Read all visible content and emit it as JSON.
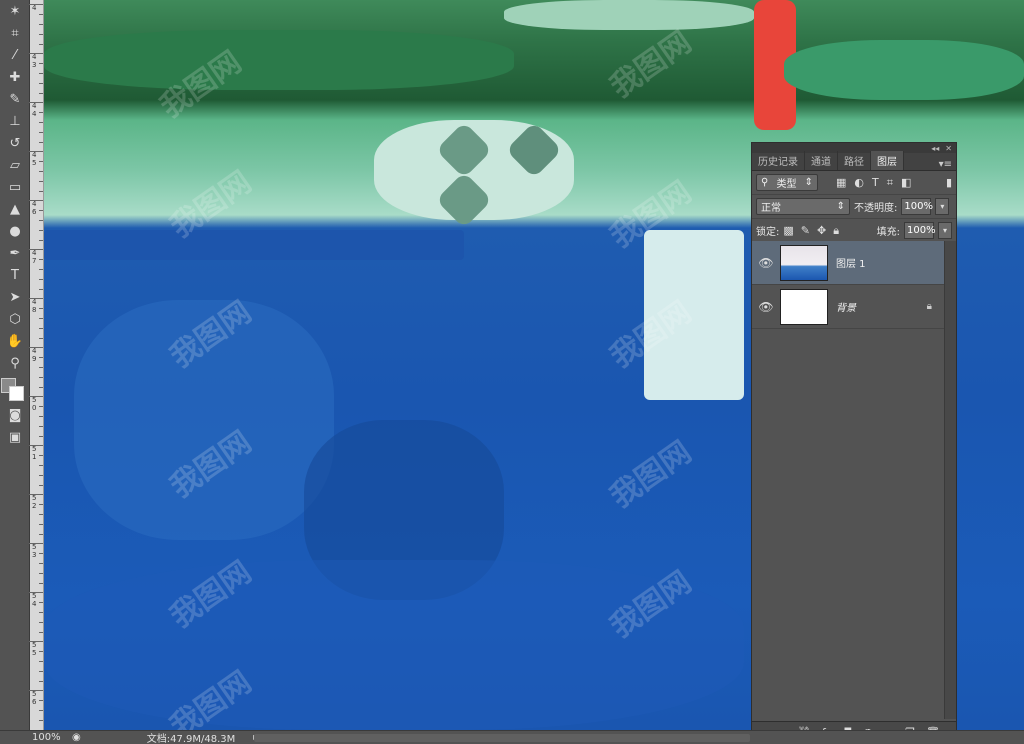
{
  "toolbar": {
    "tools": [
      {
        "name": "magic-wand-icon",
        "glyph": "✶"
      },
      {
        "name": "crop-icon",
        "glyph": "⌗"
      },
      {
        "name": "eyedropper-icon",
        "glyph": "⁄"
      },
      {
        "name": "healing-brush-icon",
        "glyph": "✚"
      },
      {
        "name": "brush-icon",
        "glyph": "✎"
      },
      {
        "name": "clone-stamp-icon",
        "glyph": "⊥"
      },
      {
        "name": "history-brush-icon",
        "glyph": "↺"
      },
      {
        "name": "eraser-icon",
        "glyph": "▱"
      },
      {
        "name": "gradient-icon",
        "glyph": "▭"
      },
      {
        "name": "blur-icon",
        "glyph": "▲"
      },
      {
        "name": "dodge-icon",
        "glyph": "●"
      },
      {
        "name": "pen-icon",
        "glyph": "✒"
      },
      {
        "name": "type-icon",
        "glyph": "T"
      },
      {
        "name": "path-selection-icon",
        "glyph": "➤"
      },
      {
        "name": "shape-icon",
        "glyph": "⬡"
      },
      {
        "name": "hand-icon",
        "glyph": "✋"
      },
      {
        "name": "zoom-icon",
        "glyph": "⚲"
      }
    ]
  },
  "ruler": {
    "labels": [
      "4",
      "4\n3",
      "4\n4",
      "4\n5",
      "4\n6",
      "4\n7",
      "4\n8",
      "4\n9",
      "5\n0",
      "5\n1",
      "5\n2",
      "5\n3",
      "5\n4",
      "5\n5",
      "5\n6"
    ]
  },
  "status": {
    "zoom": "100%",
    "doc": "文档:47.9M/48.3M"
  },
  "panel": {
    "tabs": [
      "历史记录",
      "通道",
      "路径",
      "图层"
    ],
    "active_tab": 3,
    "filter_kind": "类型",
    "blend_mode": "正常",
    "opacity_label": "不透明度:",
    "opacity_value": "100%",
    "lock_label": "锁定:",
    "fill_label": "填充:",
    "fill_value": "100%",
    "layers": [
      {
        "name": "图层 1",
        "selected": true,
        "thumb": "painting",
        "locked": false
      },
      {
        "name": "背景",
        "selected": false,
        "thumb": "white",
        "locked": true
      }
    ]
  },
  "watermark": "我图网"
}
